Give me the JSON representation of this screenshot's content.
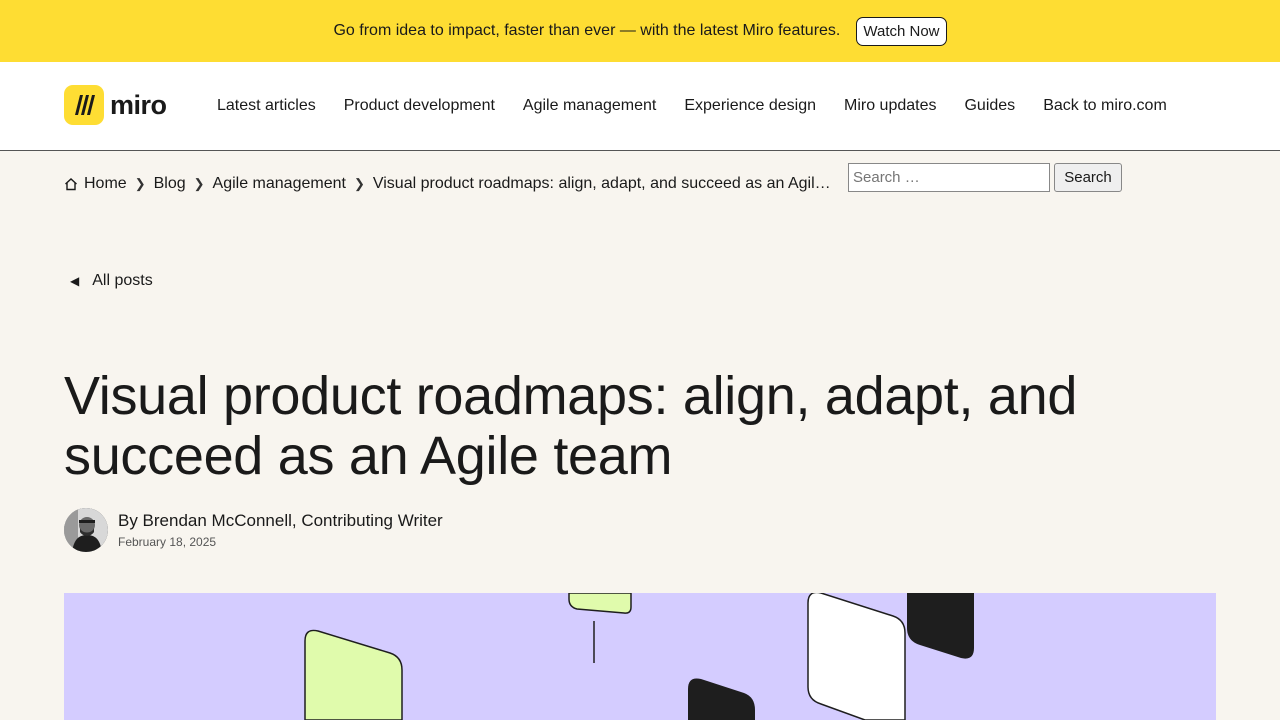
{
  "promo": {
    "text": "Go from idea to impact, faster than ever — with the latest Miro features.",
    "button": "Watch Now"
  },
  "header": {
    "logo_text": "miro",
    "nav": [
      "Latest articles",
      "Product development",
      "Agile management",
      "Experience design",
      "Miro updates",
      "Guides",
      "Back to miro.com"
    ]
  },
  "breadcrumb": {
    "home": "Home",
    "blog": "Blog",
    "category": "Agile management",
    "current": "Visual product roadmaps: align, adapt, and succeed as an Agile team"
  },
  "search": {
    "placeholder": "Search …",
    "button": "Search"
  },
  "back_link": "All posts",
  "article": {
    "title": "Visual product roadmaps: align, adapt, and succeed as an Agile team",
    "byline": "By Brendan McConnell, Contributing Writer",
    "date": "February 18, 2025"
  },
  "colors": {
    "promo_bg": "#fedd33",
    "page_bg": "#f8f5ef",
    "hero_bg": "#d4ccff",
    "lime": "#e0fbac",
    "dark": "#1e1e1e"
  }
}
